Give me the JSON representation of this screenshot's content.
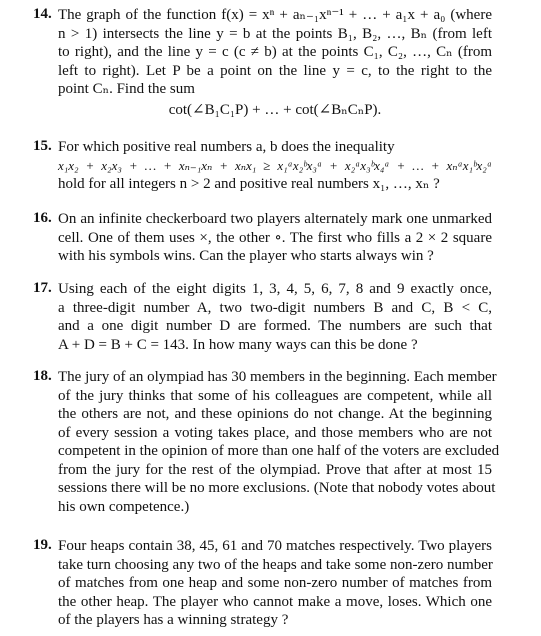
{
  "problems": [
    {
      "number": "14.",
      "lines": [
        "The graph of the function f(x) = xⁿ + aₙ₋₁xⁿ⁻¹ + … + a₁x + a₀ (where",
        "n > 1) intersects the line y = b at the points B₁, B₂, …, Bₙ (from left",
        "to right), and the line y = c (c ≠ b) at the points C₁, C₂, …, Cₙ (from",
        "left to right).  Let P be a point on the line y = c, to the right to the",
        "point Cₙ. Find the sum"
      ],
      "display": "cot(∠B₁C₁P) + … + cot(∠BₙCₙP)."
    },
    {
      "number": "15.",
      "lines": [
        "For which positive real numbers a, b does the inequality",
        "x₁x₂ + x₂x₃ + … + xₙ₋₁xₙ + xₙx₁ ≥ x₁ᵃx₂ᵇx₃ᵃ + x₂ᵃx₃ᵇx₄ᵃ + … + xₙᵃx₁ᵇx₂ᵃ",
        "hold for all integers n > 2 and positive real numbers x₁, …, xₙ ?"
      ]
    },
    {
      "number": "16.",
      "lines": [
        "On an infinite checkerboard two players alternately mark one unmarked",
        "cell. One of them uses ×, the other ∘. The first who fills a 2 × 2 square",
        "with his symbols wins. Can the player who starts always win ?"
      ]
    },
    {
      "number": "17.",
      "lines": [
        "Using each of the eight digits 1, 3, 4, 5, 6, 7, 8 and 9 exactly once,",
        "a three-digit number A, two two-digit numbers B and C, B < C,",
        "and a one digit number D are formed.  The numbers are such that",
        "A + D = B + C = 143. In how many ways can this be done ?"
      ]
    },
    {
      "number": "18.",
      "lines": [
        "The jury of an olympiad has 30 members in the beginning. Each member",
        "of the jury thinks that some of his colleagues are competent, while all",
        "the others are not, and these opinions do not change. At the beginning",
        "of every session a voting takes place, and those members who are not",
        "competent in the opinion of more than one half of the voters are excluded",
        "from the jury for the rest of the olympiad.  Prove that after at most 15",
        "sessions there will be no more exclusions. (Note that nobody votes about",
        "his own competence.)"
      ]
    },
    {
      "number": "19.",
      "lines": [
        "Four heaps contain 38, 45, 61 and 70 matches respectively. Two players",
        "take turn choosing any two of the heaps and take some non-zero number",
        "of matches from one heap and some non-zero number of matches from",
        "the other heap. The player who cannot make a move, loses.  Which one",
        "of the players has a winning strategy ?"
      ]
    }
  ]
}
